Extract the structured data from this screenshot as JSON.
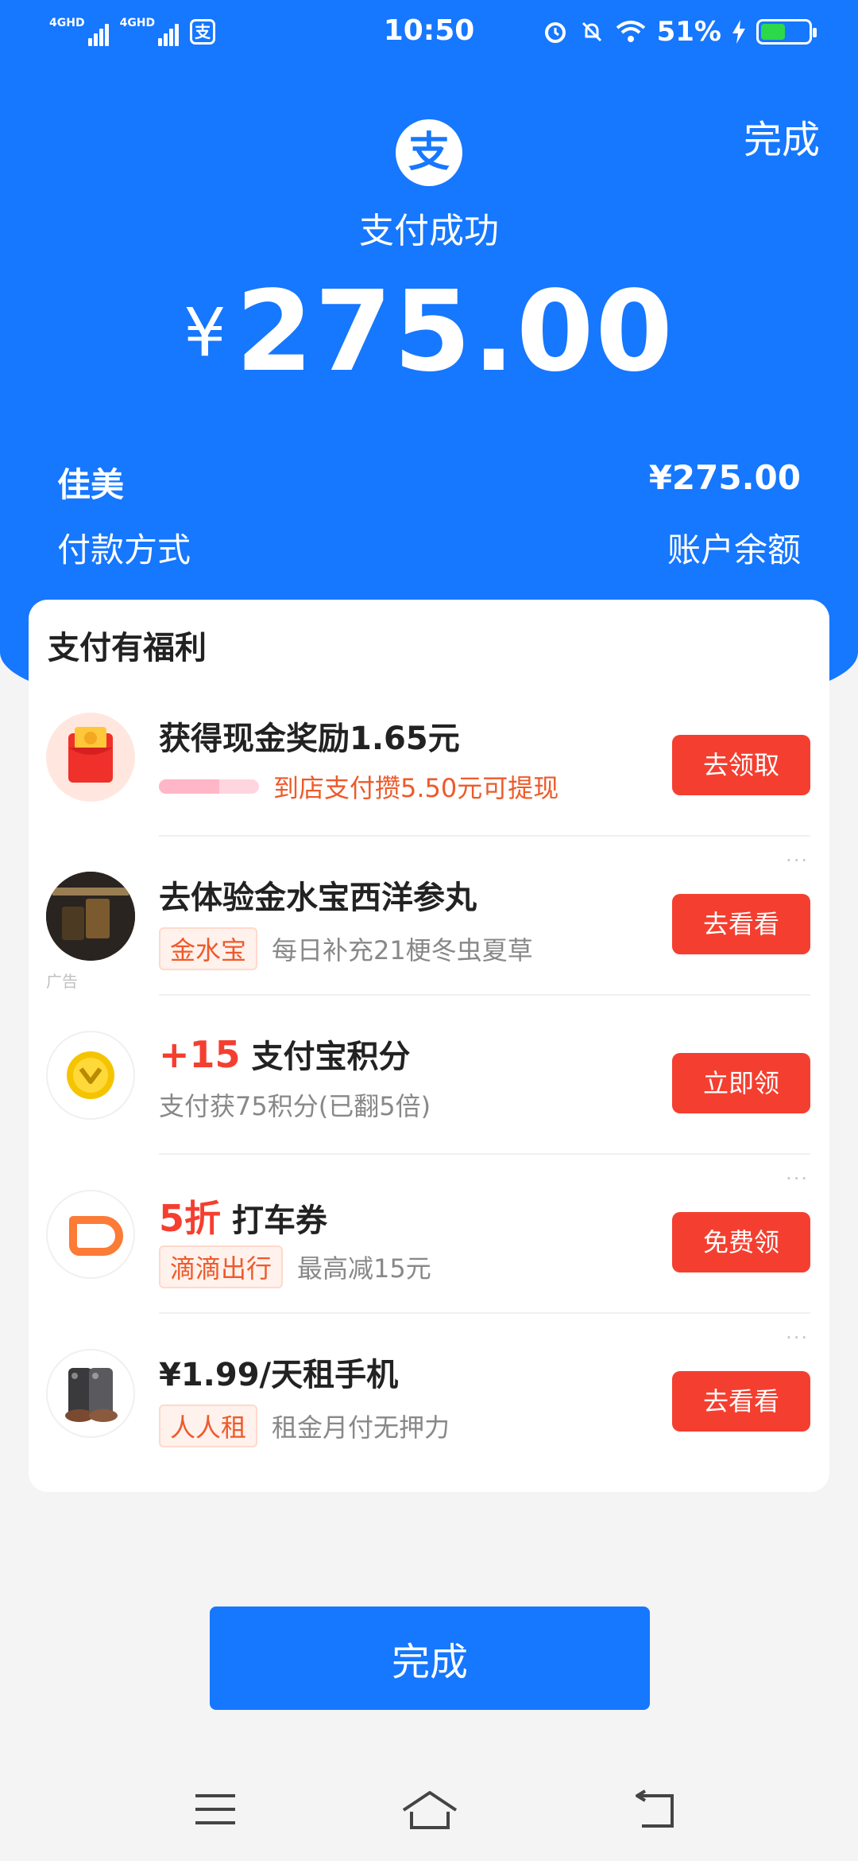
{
  "status_bar": {
    "net1": "4GHD",
    "net2": "4GHD",
    "app_glyph": "支",
    "time": "10:50",
    "battery": "51%",
    "battery_level": 0.51,
    "icons": [
      "alarm-icon",
      "mute-icon",
      "wifi-icon",
      "charging-icon",
      "battery-icon"
    ]
  },
  "header": {
    "done_label": "完成",
    "logo_glyph": "支",
    "success_text": "支付成功",
    "currency": "¥",
    "amount": "275.00"
  },
  "info": {
    "payee": "佳美",
    "paid_amount": "¥275.00",
    "method_label": "付款方式",
    "method_value": "账户余额"
  },
  "card": {
    "title": "支付有福利",
    "items": [
      {
        "title": "获得现金奖励1.65元",
        "progress": 0.6,
        "subtitle": "到店支付攒5.50元可提现",
        "button": "去领取",
        "icon": "red-envelope-icon"
      },
      {
        "title": "去体验金水宝西洋参丸",
        "tag": "金水宝",
        "subtitle": "每日补充21梗冬虫夏草",
        "button": "去看看",
        "ad": "广告",
        "more": "···",
        "icon": "product-image-icon"
      },
      {
        "highlight": "+15",
        "title": "支付宝积分",
        "subtitle": "支付获75积分(已翻5倍)",
        "button": "立即领",
        "icon": "points-coin-icon"
      },
      {
        "highlight": "5折",
        "title": "打车券",
        "tag": "滴滴出行",
        "subtitle": "最高减15元",
        "button": "免费领",
        "more": "···",
        "icon": "didi-icon"
      },
      {
        "title": "¥1.99/天租手机",
        "tag": "人人租",
        "subtitle": "租金月付无押力",
        "button": "去看看",
        "more": "···",
        "icon": "phone-rent-icon"
      }
    ]
  },
  "bottom": {
    "done_label": "完成"
  },
  "navbar": {
    "icons": [
      "menu-icon",
      "home-icon",
      "back-icon"
    ]
  },
  "colors": {
    "primary_blue": "#1677ff",
    "button_red": "#f43f30",
    "tag_orange": "#ee5a2a"
  }
}
